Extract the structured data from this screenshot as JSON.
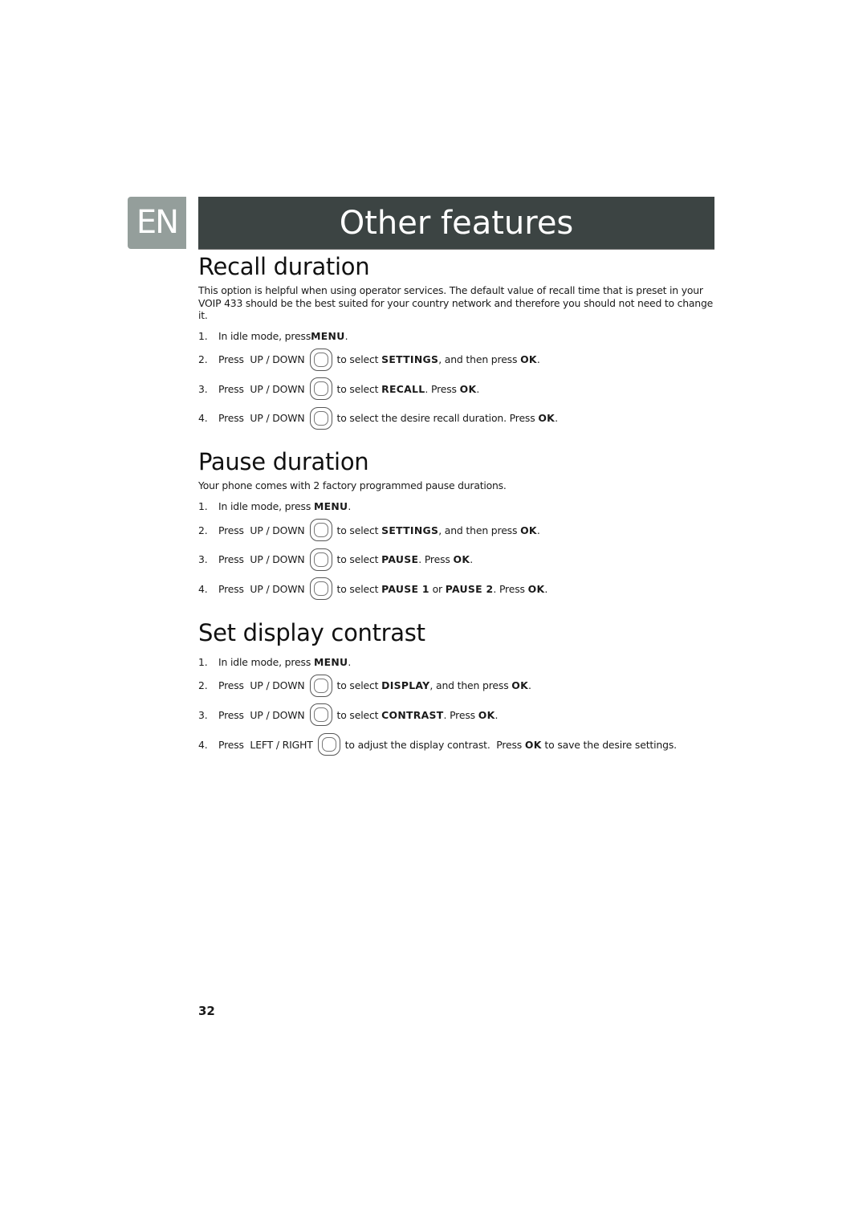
{
  "header": {
    "language_tab": "EN",
    "title": "Other features",
    "colors": {
      "tab": "#949e9b",
      "bar": "#3c4443"
    }
  },
  "sections": [
    {
      "title": "Recall duration",
      "intro": "This option is helpful when using operator services. The default value of recall time that is preset in your VOIP 433 should be the best suited for your country network and therefore you should not need to change it.",
      "steps": [
        {
          "num": "1.",
          "pre": "In idle mode, press ",
          "bold1": "MENU",
          "post": "."
        },
        {
          "num": "2.",
          "action": "Press  UP / DOWN",
          "icon": "navigation-key-icon",
          "pre": "to select ",
          "bold1": "SETTINGS",
          "mid": ", and then press ",
          "bold2": "OK",
          "post": "."
        },
        {
          "num": "3.",
          "action": "Press  UP / DOWN",
          "icon": "navigation-key-icon",
          "pre": "to select ",
          "bold1": "RECALL",
          "mid": ". Press ",
          "bold2": "OK",
          "post": "."
        },
        {
          "num": "4.",
          "action": "Press  UP / DOWN",
          "icon": "navigation-key-icon",
          "pre": "to select the desire recall duration. Press ",
          "bold1": "OK",
          "post": "."
        }
      ]
    },
    {
      "title": "Pause duration",
      "intro": "Your phone comes with 2 factory programmed pause durations.",
      "steps": [
        {
          "num": "1.",
          "pre": "In idle mode, press ",
          "bold1": "MENU",
          "post": "."
        },
        {
          "num": "2.",
          "action": "Press  UP / DOWN",
          "icon": "navigation-key-icon",
          "pre": "to select ",
          "bold1": "SETTINGS",
          "mid": ", and then press ",
          "bold2": "OK",
          "post": "."
        },
        {
          "num": "3.",
          "action": "Press  UP / DOWN",
          "icon": "navigation-key-icon",
          "pre": "to select ",
          "bold1": "PAUSE",
          "mid": ". Press ",
          "bold2": "OK",
          "post": "."
        },
        {
          "num": "4.",
          "action": "Press  UP / DOWN",
          "icon": "navigation-key-icon",
          "pre": "to select ",
          "bold1": "PAUSE 1",
          "mid": " or ",
          "bold2": "PAUSE 2",
          "mid2": ". Press ",
          "bold3": "OK",
          "post": "."
        }
      ]
    },
    {
      "title": "Set display contrast",
      "steps": [
        {
          "num": "1.",
          "pre": "In idle mode, press ",
          "bold1": "MENU",
          "post": "."
        },
        {
          "num": "2.",
          "action": "Press  UP / DOWN",
          "icon": "navigation-key-icon",
          "pre": "to select ",
          "bold1": "DISPLAY",
          "mid": ", and then press ",
          "bold2": "OK",
          "post": "."
        },
        {
          "num": "3.",
          "action": "Press  UP / DOWN",
          "icon": "navigation-key-icon",
          "pre": "to select ",
          "bold1": "CONTRAST",
          "mid": ". Press ",
          "bold2": "OK",
          "post": "."
        },
        {
          "num": "4.",
          "action": "Press  LEFT / RIGHT",
          "icon": "navigation-key-icon",
          "pre": "to adjust the display contrast.  Press ",
          "bold1": "OK",
          "mid": " to save the desire settings.",
          "post": ""
        }
      ]
    }
  ],
  "footer": {
    "page_number": "32"
  }
}
